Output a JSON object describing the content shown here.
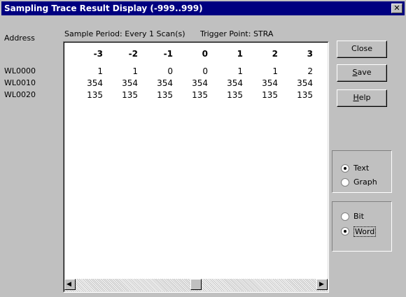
{
  "window": {
    "title": "Sampling Trace Result Display (-999..999)",
    "close_glyph": "✕"
  },
  "header": {
    "address_label": "Address",
    "sample_period": "Sample Period: Every 1 Scan(s)",
    "trigger_point": "Trigger Point: STRA"
  },
  "table": {
    "columns": [
      "-3",
      "-2",
      "-1",
      "0",
      "1",
      "2",
      "3"
    ],
    "rows": [
      {
        "address": "WL0000",
        "values": [
          "1",
          "1",
          "0",
          "0",
          "1",
          "1",
          "2"
        ]
      },
      {
        "address": "WL0010",
        "values": [
          "354",
          "354",
          "354",
          "354",
          "354",
          "354",
          "354"
        ]
      },
      {
        "address": "WL0020",
        "values": [
          "135",
          "135",
          "135",
          "135",
          "135",
          "135",
          "135"
        ]
      }
    ]
  },
  "buttons": {
    "close": "Close",
    "save_pre": "",
    "save_u": "S",
    "save_post": "ave",
    "help_pre": "",
    "help_u": "H",
    "help_post": "elp"
  },
  "display_mode": {
    "options": [
      "Text",
      "Graph"
    ],
    "selected": "Text"
  },
  "data_type": {
    "options": [
      "Bit",
      "Word"
    ],
    "selected": "Word"
  },
  "scrollbar": {
    "left_arrow": "◀",
    "right_arrow": "▶",
    "position_fraction": 0.5
  }
}
